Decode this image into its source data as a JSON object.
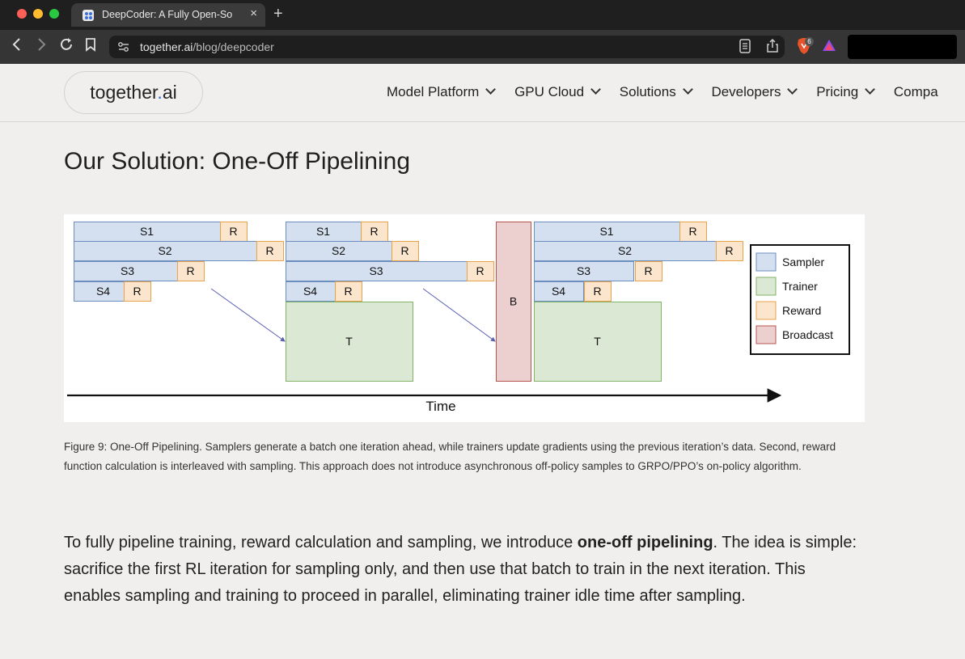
{
  "browser": {
    "tab_title": "DeepCoder: A Fully Open-So",
    "tab_close": "×",
    "new_tab": "+",
    "url_domain": "together.ai",
    "url_path": "/blog/deepcoder",
    "shield_count": "6"
  },
  "site": {
    "logo_main": "together",
    "logo_dot": ".",
    "logo_suffix": "ai",
    "nav": [
      "Model Platform",
      "GPU Cloud",
      "Solutions",
      "Developers",
      "Pricing",
      "Compa"
    ]
  },
  "article": {
    "heading": "Our Solution: One-Off Pipelining",
    "caption": "Figure 9: One-Off Pipelining. Samplers generate a batch one iteration ahead, while trainers update gradients using the previous iteration’s data. Second, reward function calculation is interleaved with sampling. This approach does not introduce asynchronous off-policy samples to GRPO/PPO’s on-policy algorithm.",
    "para_part1": "To fully pipeline training, reward calculation and sampling, we introduce ",
    "para_bold": "one-off pipelining",
    "para_part2": ". The idea is simple: sacrifice the first RL iteration for sampling only, and then use that batch to train in the next iteration. This enables sampling and training to proceed in parallel, eliminating trainer idle time after sampling."
  },
  "diagram": {
    "sampler_labels": [
      "S1",
      "S2",
      "S3",
      "S4"
    ],
    "reward_label": "R",
    "trainer_label": "T",
    "broadcast_label": "B",
    "axis_label": "Time",
    "legend": [
      "Sampler",
      "Trainer",
      "Reward",
      "Broadcast"
    ],
    "colors": {
      "sampler": "#d4e0f0",
      "sampler_border": "#6c8ebf",
      "trainer": "#dbe8d4",
      "trainer_border": "#82b366",
      "reward": "#fbe5cc",
      "reward_border": "#e8a24c",
      "broadcast": "#eccfcf",
      "broadcast_border": "#b85450"
    }
  }
}
